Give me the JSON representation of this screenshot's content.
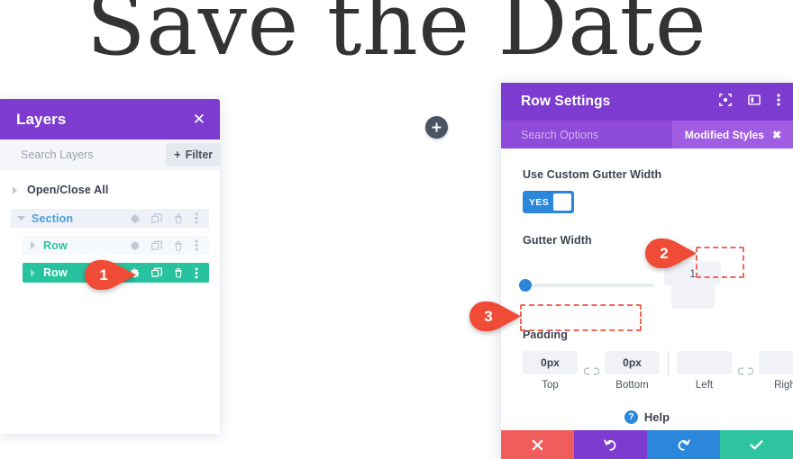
{
  "hero": {
    "title": "Save the Date"
  },
  "canvas": {
    "add_button_icon": "plus-icon",
    "add_button_label": "+"
  },
  "layers_panel": {
    "title": "Layers",
    "close_icon": "close-icon",
    "close_label": "✕",
    "search": {
      "placeholder": "Search Layers",
      "value": ""
    },
    "filter_button": {
      "label": "Filter",
      "plus": "+"
    },
    "tree": [
      {
        "label": "Open/Close All",
        "type": "toggle-all",
        "expanded": false,
        "actions": []
      },
      {
        "label": "Section",
        "type": "section",
        "expanded": true,
        "actions": [
          "gear-icon",
          "duplicate-icon",
          "trash-icon",
          "more-icon"
        ]
      },
      {
        "label": "Row",
        "type": "row",
        "expanded": false,
        "active": false,
        "actions": [
          "gear-icon",
          "duplicate-icon",
          "trash-icon",
          "more-icon"
        ]
      },
      {
        "label": "Row",
        "type": "row",
        "expanded": false,
        "active": true,
        "actions": [
          "gear-icon",
          "duplicate-icon",
          "trash-icon",
          "more-icon"
        ]
      }
    ]
  },
  "settings_panel": {
    "title": "Row Settings",
    "header_icons": [
      "target-icon",
      "panel-layout-icon",
      "more-vertical-icon"
    ],
    "search": {
      "placeholder": "Search Options",
      "value": ""
    },
    "modified_styles": {
      "label": "Modified Styles",
      "close_label": "✖"
    },
    "fields": {
      "custom_gutter": {
        "label": "Use Custom Gutter Width",
        "toggle_value": "YES"
      },
      "gutter_width": {
        "label": "Gutter Width",
        "value": "1",
        "unit": "",
        "slider_percent": 0
      },
      "padding": {
        "label": "Padding",
        "link_icon": "broken-link-icon",
        "cells": [
          {
            "caption": "Top",
            "value": "0px"
          },
          {
            "caption": "Bottom",
            "value": "0px"
          },
          {
            "caption": "Left",
            "value": ""
          },
          {
            "caption": "Right",
            "value": ""
          }
        ]
      }
    },
    "help": {
      "icon": "question-icon",
      "label": "Help"
    },
    "footer_buttons": [
      {
        "name": "cancel-button",
        "icon": "close-icon",
        "glyph": "✖",
        "color": "#f05d5d"
      },
      {
        "name": "undo-button",
        "icon": "undo-icon",
        "glyph": "↺",
        "color": "#7e3bd0"
      },
      {
        "name": "redo-button",
        "icon": "redo-icon",
        "glyph": "↻",
        "color": "#2b87da"
      },
      {
        "name": "save-button",
        "icon": "checkmark-icon",
        "glyph": "✔",
        "color": "#2ec4a0"
      }
    ]
  },
  "callouts": [
    {
      "number": "1",
      "target": "layers-row-settings-gear"
    },
    {
      "number": "2",
      "target": "gutter-width-value"
    },
    {
      "number": "3",
      "target": "padding-top-bottom"
    }
  ],
  "colors": {
    "purple": "#7e3bd0",
    "purple_light": "#8e4ad9",
    "purple_pill": "#a05de3",
    "teal": "#26c39e",
    "blue": "#2b87da",
    "red": "#f05d5d",
    "highlight": "#f0685a",
    "text_dark": "#3d4351"
  }
}
